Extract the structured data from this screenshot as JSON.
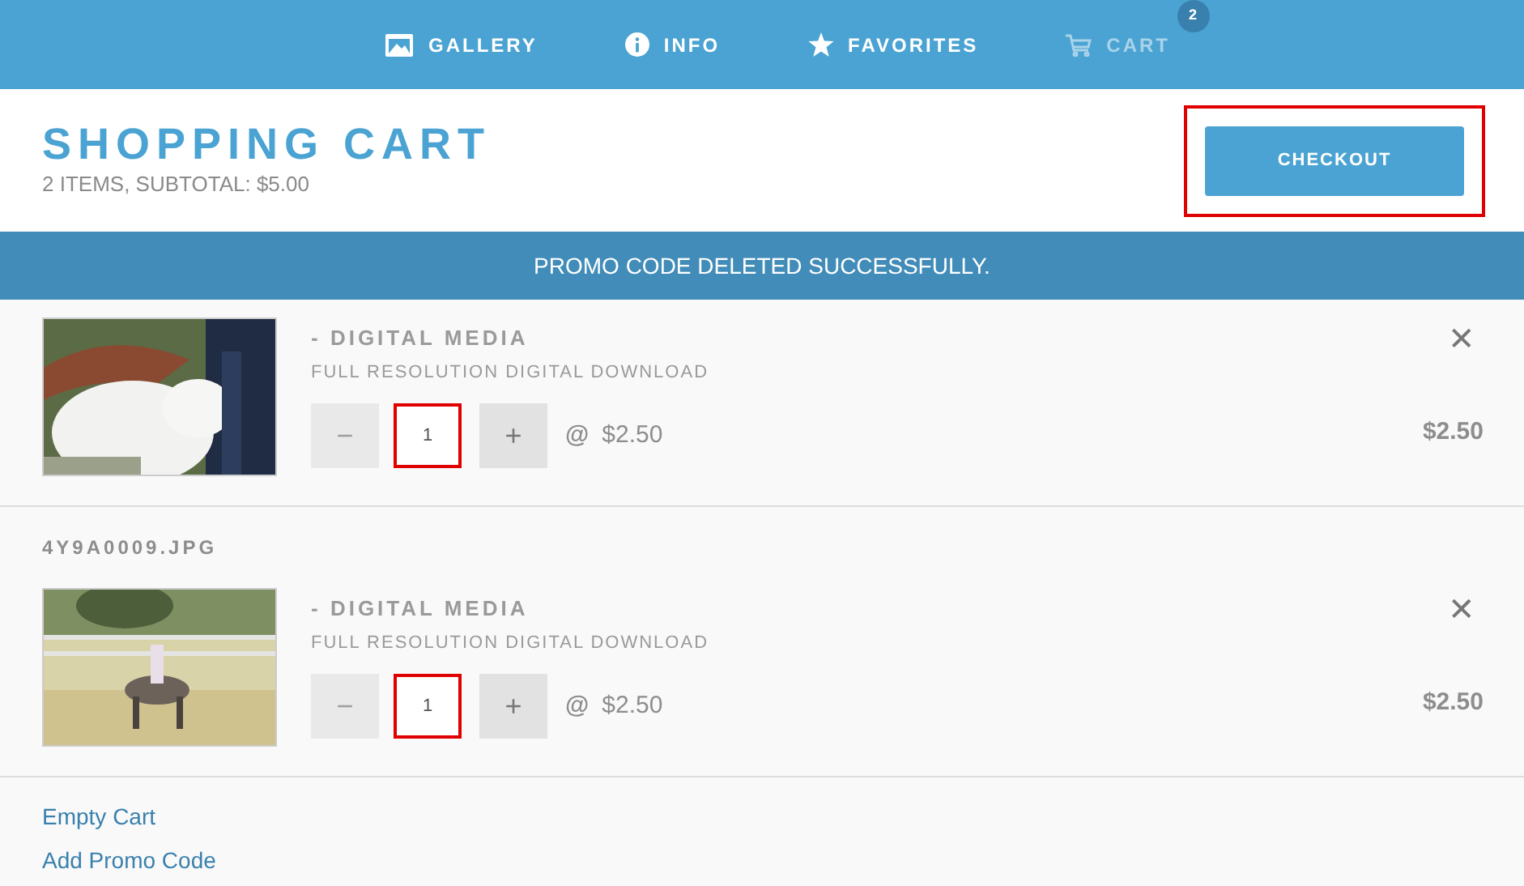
{
  "nav": [
    {
      "label": "GALLERY",
      "kind": "gallery",
      "selected": false
    },
    {
      "label": "INFO",
      "kind": "info",
      "selected": false
    },
    {
      "label": "FAVORITES",
      "kind": "star",
      "selected": false
    },
    {
      "label": "CART",
      "kind": "cart",
      "selected": true,
      "badge": "2"
    }
  ],
  "header": {
    "title": "SHOPPING CART",
    "subtitle": "2 ITEMS, SUBTOTAL: $5.00",
    "checkout": {
      "label": "CHECKOUT",
      "highlighted": true
    }
  },
  "notice": "PROMO CODE DELETED SUCCESSFULLY.",
  "items": [
    {
      "product": "- DIGITAL MEDIA",
      "description": "FULL RESOLUTION DIGITAL DOWNLOAD",
      "decrement": "−",
      "quantity": "1",
      "increment": "+",
      "quantity_highlighted": true,
      "decrement_disabled": true,
      "unit_symbol": "@",
      "unit_price": "$2.50",
      "total": "$2.50",
      "remove": "✕"
    },
    {
      "filename": "4Y9A0009.JPG",
      "product": "- DIGITAL MEDIA",
      "description": "FULL RESOLUTION DIGITAL DOWNLOAD",
      "decrement": "−",
      "quantity": "1",
      "increment": "+",
      "quantity_highlighted": true,
      "decrement_disabled": true,
      "unit_symbol": "@",
      "unit_price": "$2.50",
      "total": "$2.50",
      "remove": "✕"
    }
  ],
  "links": [
    "Empty Cart",
    "Add Promo Code"
  ]
}
